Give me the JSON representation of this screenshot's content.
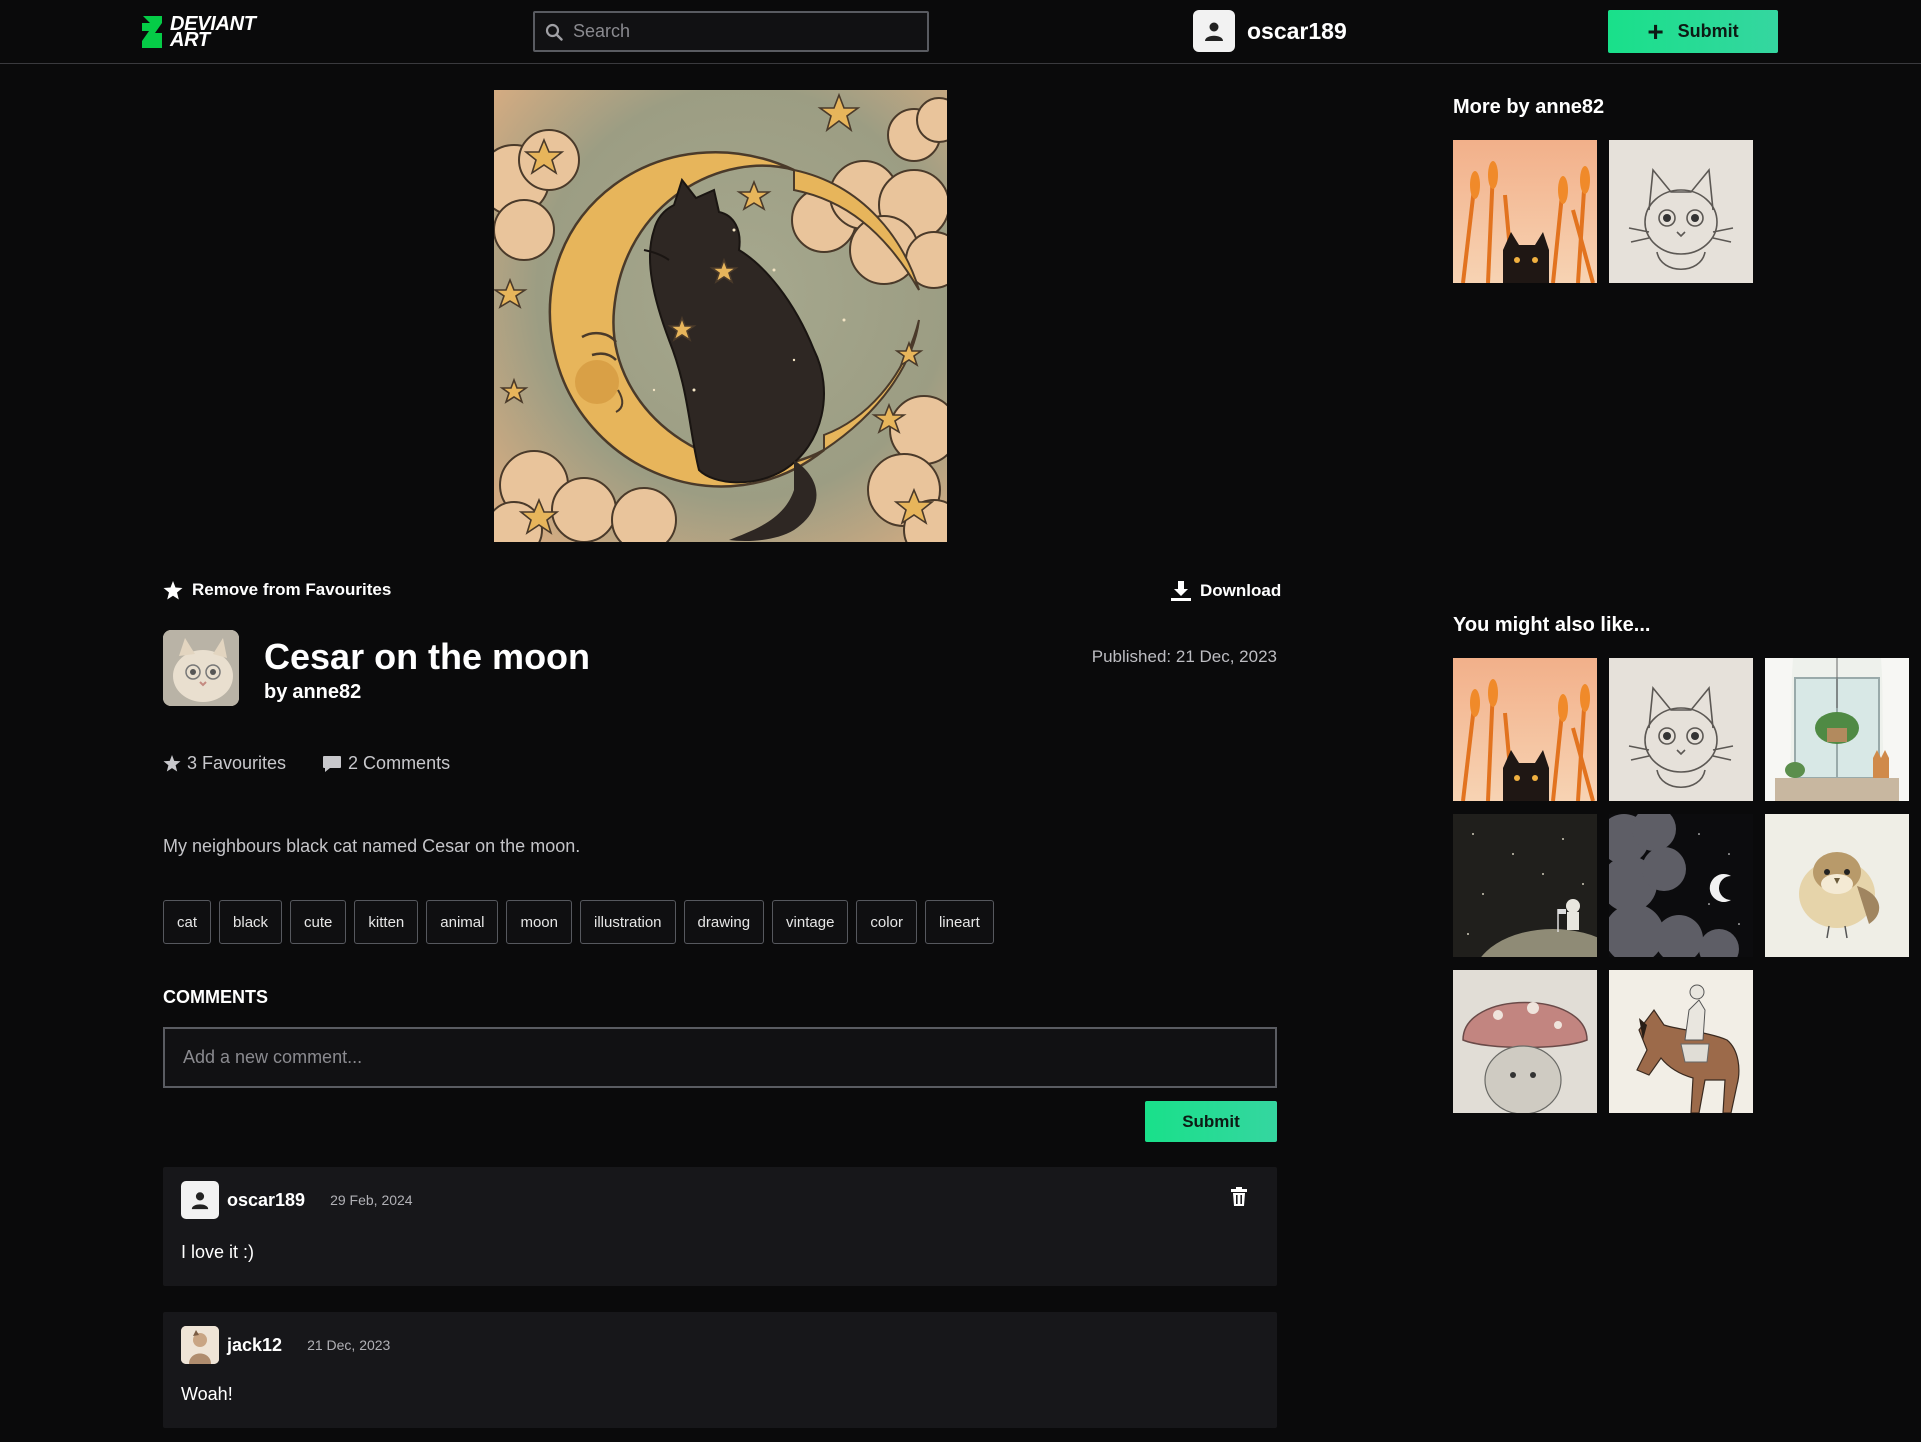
{
  "header": {
    "logo_line1": "DEVIANT",
    "logo_line2": "ART",
    "search_placeholder": "Search",
    "username": "oscar189",
    "submit_label": "Submit"
  },
  "artwork": {
    "image_icon": "crescent-moon-cat-illustration",
    "favourite_action_label": "Remove from Favourites",
    "download_label": "Download",
    "title": "Cesar on the moon",
    "by_prefix": "by",
    "author": "anne82",
    "published": "Published: 21 Dec, 2023",
    "favourites_label": "3 Favourites",
    "comments_label": "2 Comments",
    "description": "My neighbours black cat named Cesar on the moon.",
    "tags": [
      "cat",
      "black",
      "cute",
      "kitten",
      "animal",
      "moon",
      "illustration",
      "drawing",
      "vintage",
      "color",
      "lineart"
    ]
  },
  "comments": {
    "heading": "COMMENTS",
    "input_placeholder": "Add a new comment...",
    "submit_label": "Submit",
    "items": [
      {
        "user": "oscar189",
        "date": "29 Feb, 2024",
        "text": "I love it :)",
        "deletable": true
      },
      {
        "user": "jack12",
        "date": "21 Dec, 2023",
        "text": "Woah!",
        "deletable": false
      }
    ]
  },
  "sidebar": {
    "more_by_heading": "More by anne82",
    "more_by_thumbs": [
      "wheat-field-cat",
      "cat-sketch"
    ],
    "also_like_heading": "You might also like...",
    "also_like_thumbs": [
      "wheat-field-cat",
      "cat-sketch",
      "window-plant-cat",
      "astronaut-moon",
      "night-clouds-moon",
      "sparrow",
      "mushroom-hedgehog",
      "horse-rider"
    ]
  },
  "colors": {
    "background": "#0a0a0b",
    "accent": "#19e08a",
    "card": "#17171a"
  }
}
